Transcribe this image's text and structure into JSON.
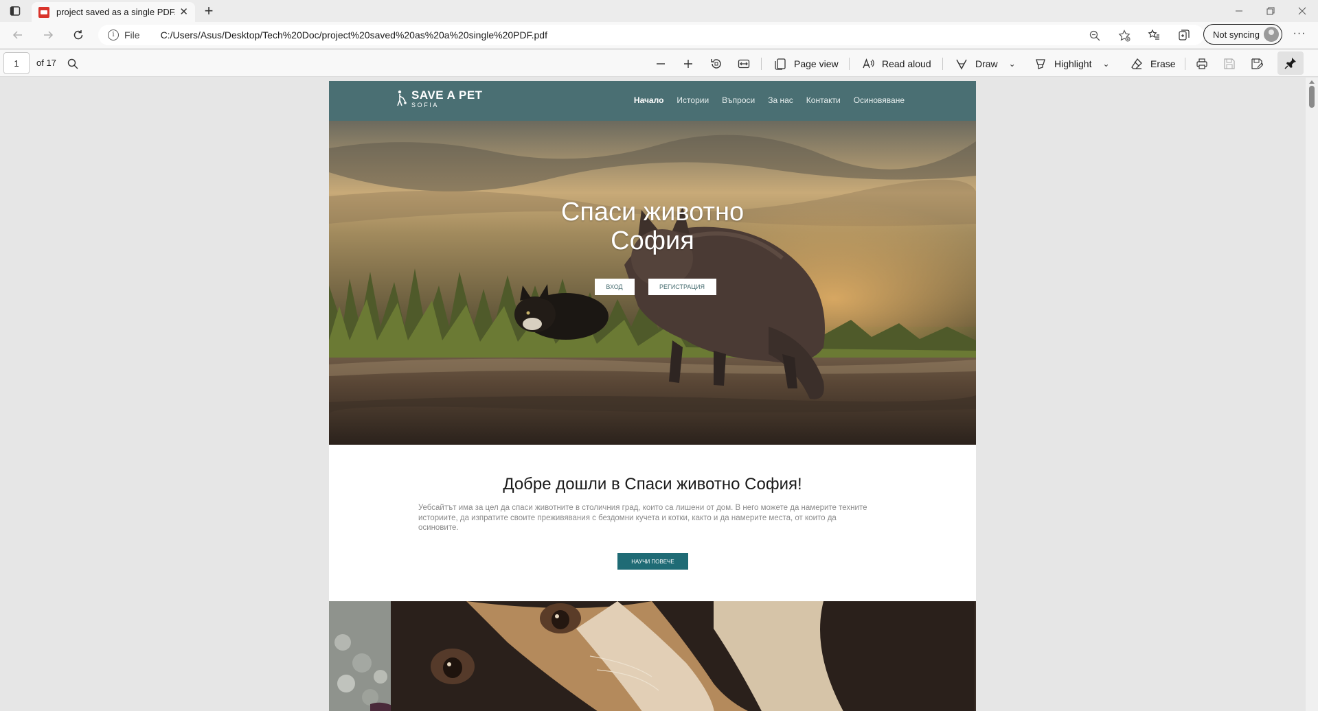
{
  "browser": {
    "tab_title": "project saved as a single PDF.pdf",
    "new_tab": "+",
    "url_scheme": "File",
    "url": "C:/Users/Asus/Desktop/Tech%20Doc/project%20saved%20as%20a%20single%20PDF.pdf",
    "sync_label": "Not syncing"
  },
  "pdf_toolbar": {
    "page_current": "1",
    "page_total": "of 17",
    "page_view": "Page view",
    "read_aloud": "Read aloud",
    "draw": "Draw",
    "highlight": "Highlight",
    "erase": "Erase"
  },
  "site": {
    "logo_name": "SAVE A PET",
    "logo_sub": "SOFIA",
    "nav": [
      "Начало",
      "Истории",
      "Въпроси",
      "За нас",
      "Контакти",
      "Осиновяване"
    ],
    "hero_title_line1": "Спаси животно",
    "hero_title_line2": "София",
    "hero_login": "ВХОД",
    "hero_register": "РЕГИСТРАЦИЯ",
    "welcome_title": "Добре дошли в Спаси животно София!",
    "welcome_text": "Уебсайтът има за цел да спаси животните в столичния град, които са лишени от дом. В него можете да намерите техните историите, да изпратите своите преживявания с бездомни кучета и котки, както и да намерите места, от които да осиновите.",
    "learn_more": "НАУЧИ ПОВЕЧЕ"
  },
  "colors": {
    "site_header": "#4a6f73",
    "learn_button": "#1f6b75"
  }
}
